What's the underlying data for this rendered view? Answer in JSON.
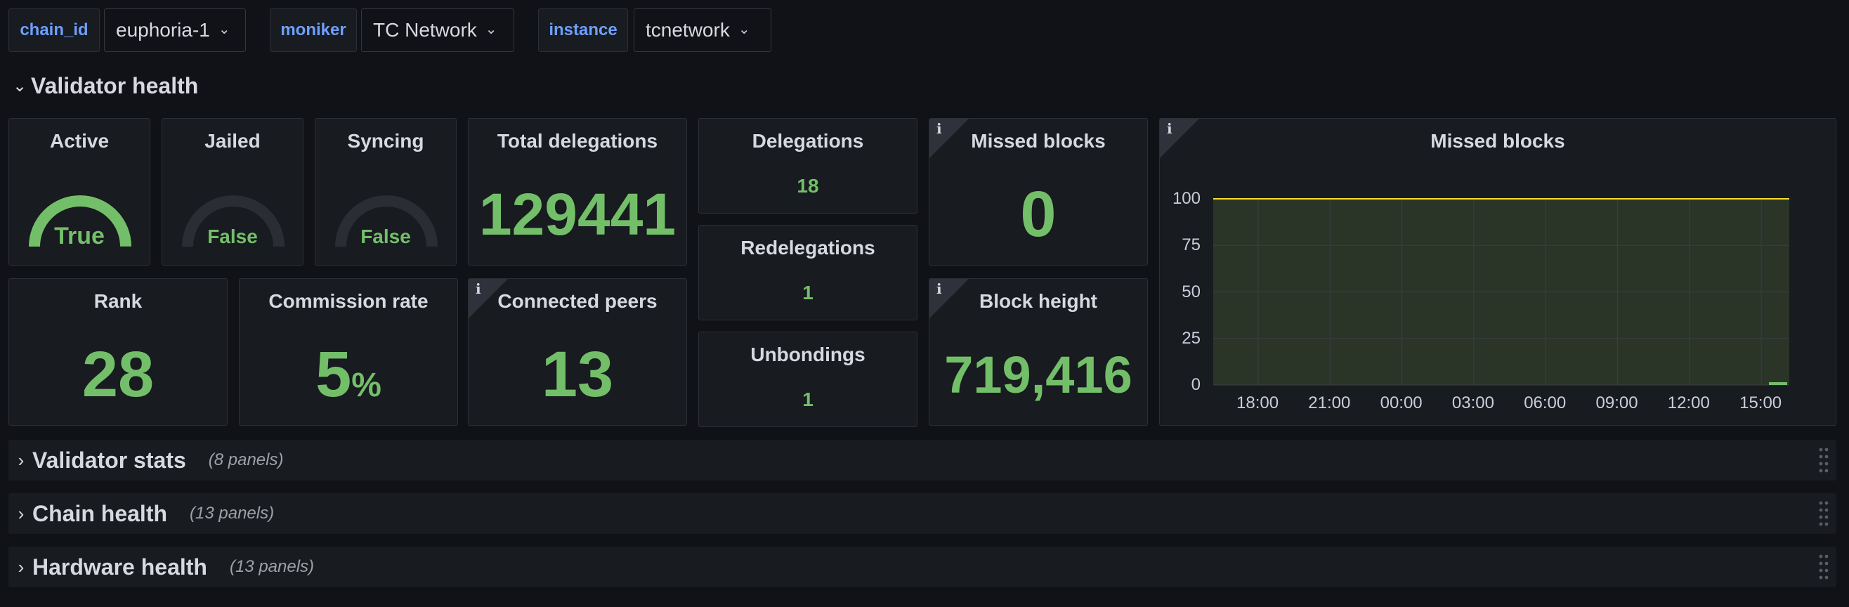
{
  "variables": [
    {
      "label": "chain_id",
      "value": "euphoria-1"
    },
    {
      "label": "moniker",
      "value": "TC Network"
    },
    {
      "label": "instance",
      "value": "tcnetwork"
    }
  ],
  "rows": {
    "validator_health": {
      "title": "Validator health"
    },
    "validator_stats": {
      "title": "Validator stats",
      "count": "(8 panels)"
    },
    "chain_health": {
      "title": "Chain health",
      "count": "(13 panels)"
    },
    "hardware_health": {
      "title": "Hardware health",
      "count": "(13 panels)"
    }
  },
  "panels": {
    "active": {
      "title": "Active",
      "value": "True",
      "level": 1.0
    },
    "jailed": {
      "title": "Jailed",
      "value": "False",
      "level": 0.0
    },
    "syncing": {
      "title": "Syncing",
      "value": "False",
      "level": 0.0
    },
    "total_delegations": {
      "title": "Total delegations",
      "value": "129441"
    },
    "delegations": {
      "title": "Delegations",
      "value": "18"
    },
    "redelegations": {
      "title": "Redelegations",
      "value": "1"
    },
    "unbondings": {
      "title": "Unbondings",
      "value": "1"
    },
    "missed_blocks_stat": {
      "title": "Missed blocks",
      "value": "0",
      "info": "i"
    },
    "rank": {
      "title": "Rank",
      "value": "28"
    },
    "commission_rate": {
      "title": "Commission rate",
      "value": "5",
      "unit": "%"
    },
    "connected_peers": {
      "title": "Connected peers",
      "value": "13",
      "info": "i"
    },
    "block_height": {
      "title": "Block height",
      "value": "719,416",
      "info": "i"
    },
    "missed_blocks_chart": {
      "title": "Missed blocks",
      "info": "i"
    }
  },
  "colors": {
    "value_green": "#73bf69",
    "series_yellow": "#fade2a",
    "label_blue": "#6e9fff"
  },
  "chart_data": {
    "type": "area",
    "title": "Missed blocks",
    "y_ticks": [
      "100",
      "75",
      "50",
      "25",
      "0"
    ],
    "x_ticks": [
      "18:00",
      "21:00",
      "00:00",
      "03:00",
      "06:00",
      "09:00",
      "12:00",
      "15:00"
    ],
    "ylim": [
      0,
      100
    ],
    "series": [
      {
        "name": "",
        "color": "#fade2a",
        "x_range": [
          "16:45",
          "16:45 +24h"
        ],
        "values": [
          100,
          100
        ]
      },
      {
        "name": "",
        "color": "#73bf69",
        "x_range": [
          "15:45",
          "16:45"
        ],
        "values": [
          0,
          0
        ]
      }
    ],
    "grid": true,
    "legend": "none"
  }
}
